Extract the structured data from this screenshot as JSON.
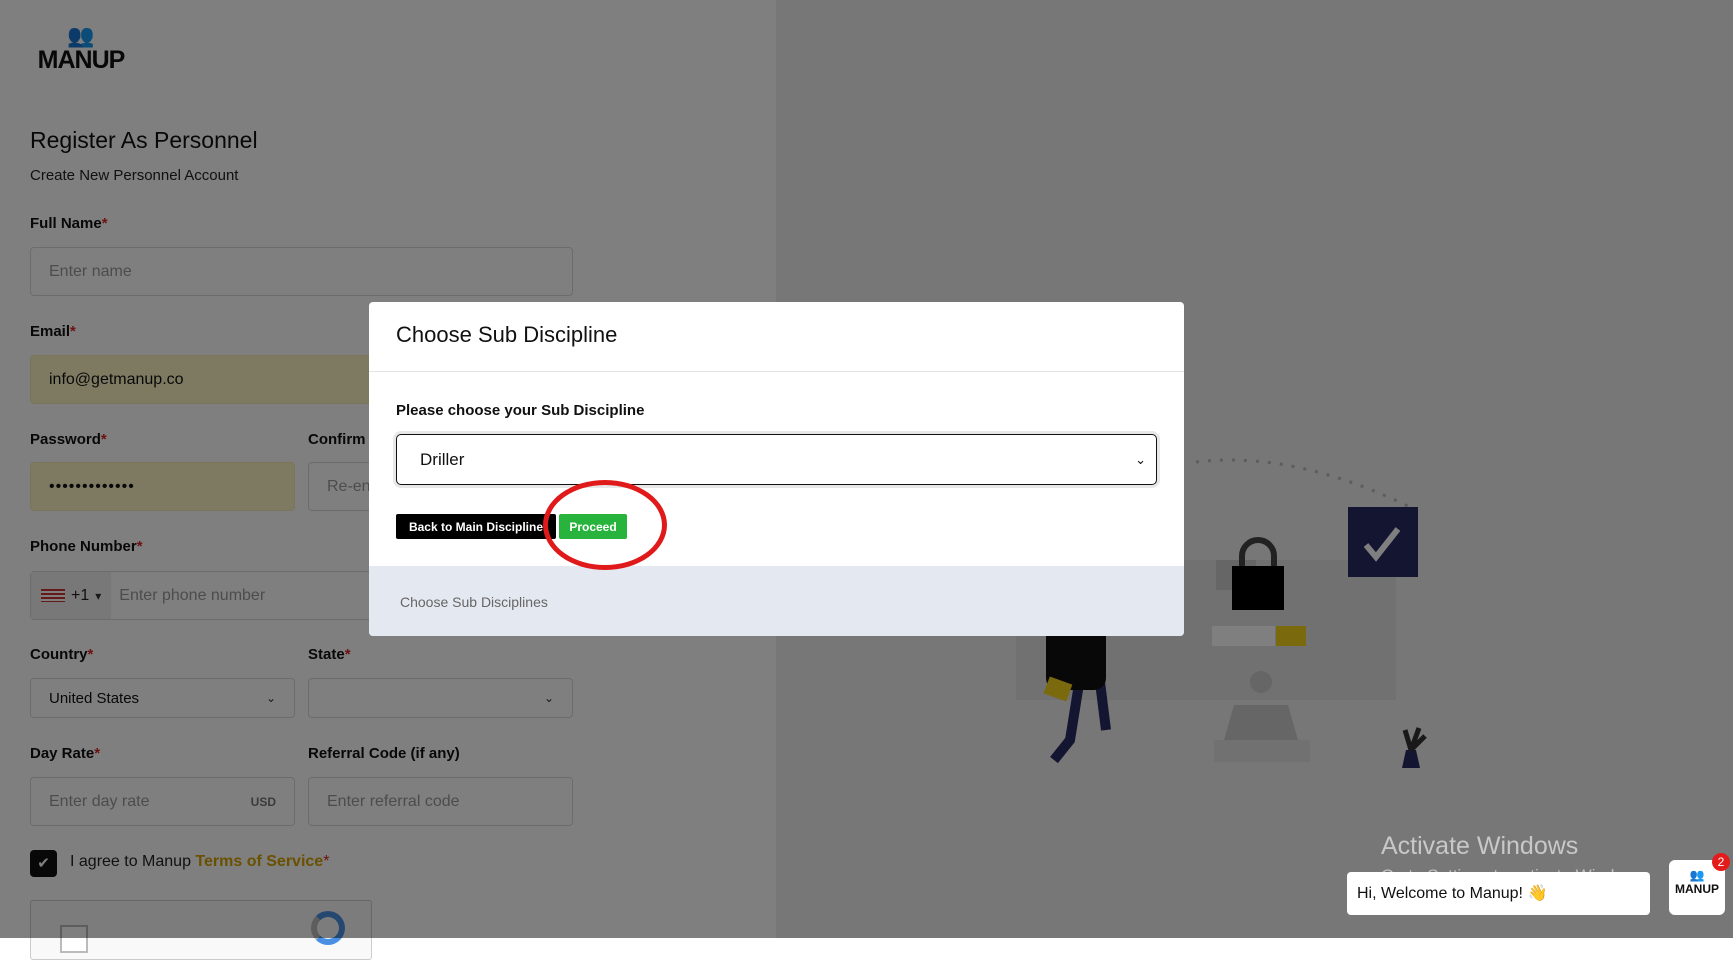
{
  "logo": {
    "text": "MANUP"
  },
  "page": {
    "title": "Register As Personnel",
    "subtitle": "Create New Personnel Account"
  },
  "form": {
    "full_name": {
      "label": "Full Name",
      "placeholder": "Enter name"
    },
    "email": {
      "label": "Email",
      "value": "info@getmanup.co"
    },
    "password": {
      "label": "Password",
      "value": "•••••••••••••"
    },
    "confirm": {
      "label": "Confirm",
      "placeholder": "Re-en"
    },
    "phone": {
      "label": "Phone Number",
      "code": "+1",
      "placeholder": "Enter phone number"
    },
    "country": {
      "label": "Country",
      "value": "United States"
    },
    "state": {
      "label": "State",
      "value": ""
    },
    "day_rate": {
      "label": "Day Rate",
      "placeholder": "Enter day rate",
      "unit": "USD"
    },
    "referral": {
      "label": "Referral Code (if any)",
      "placeholder": "Enter referral code"
    },
    "agree": {
      "text": "I agree to Manup ",
      "link": "Terms of Service",
      "checked": true
    },
    "required_mark": "*"
  },
  "modal": {
    "title": "Choose Sub Discipline",
    "label": "Please choose your Sub Discipline",
    "selected": "Driller",
    "back_label": "Back to Main Discipline",
    "proceed_label": "Proceed",
    "footer": "Choose Sub Disciplines"
  },
  "windows": {
    "title": "Activate Windows",
    "subtitle": "Go to Settings to activate Windows."
  },
  "chat": {
    "message": "Hi, Welcome to Manup! 👋",
    "badge": "2",
    "logo": "MANUP"
  }
}
